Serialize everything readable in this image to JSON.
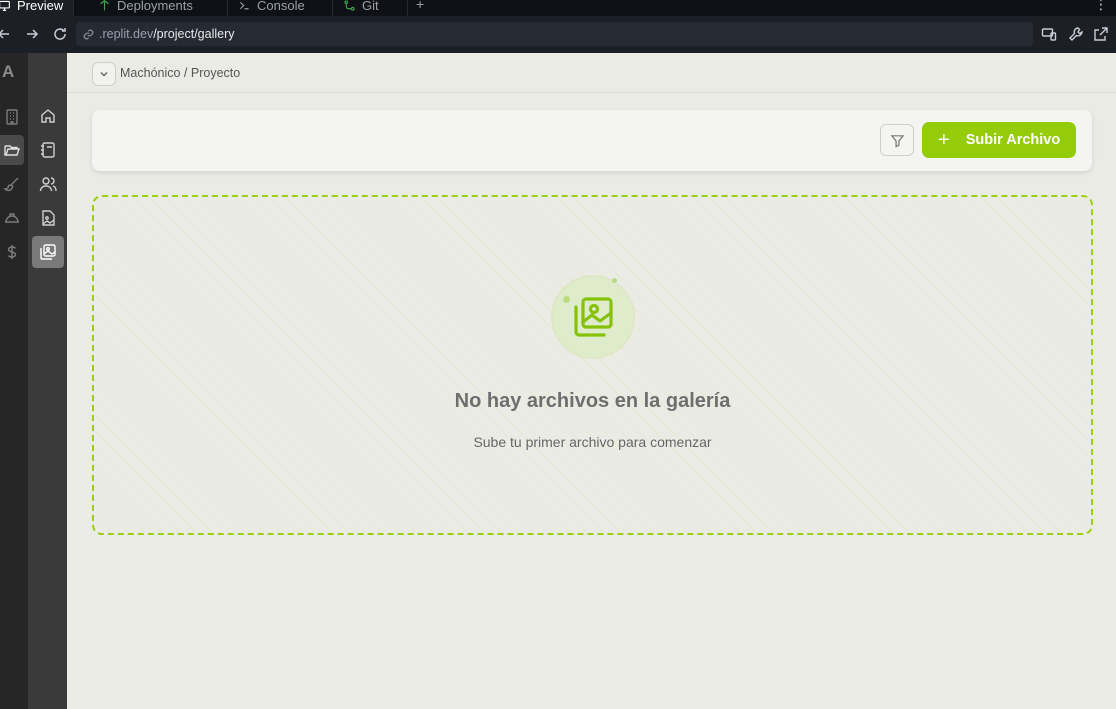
{
  "browser": {
    "tabs": [
      {
        "label": "Preview",
        "icon": "monitor-icon",
        "active": true
      },
      {
        "label": "Deployments",
        "icon": "deploy-icon",
        "active": false
      },
      {
        "label": "Console",
        "icon": "terminal-icon",
        "active": false
      },
      {
        "label": "Git",
        "icon": "git-icon",
        "active": false
      }
    ],
    "new_tab": "+",
    "menu": "⋮",
    "url_host": ".replit.dev",
    "url_path": "/project/gallery"
  },
  "rail1": {
    "logo": "A",
    "items": [
      {
        "icon": "building-icon",
        "selected": false
      },
      {
        "icon": "folder-open-icon",
        "selected": true
      },
      {
        "icon": "brush-icon",
        "selected": false
      },
      {
        "icon": "helmet-icon",
        "selected": false
      },
      {
        "icon": "dollar-icon",
        "selected": false
      }
    ]
  },
  "rail2": {
    "items": [
      {
        "icon": "home-icon",
        "selected": false
      },
      {
        "icon": "notebook-icon",
        "selected": false
      },
      {
        "icon": "users-icon",
        "selected": false
      },
      {
        "icon": "file-image-icon",
        "selected": false
      },
      {
        "icon": "gallery-icon",
        "selected": true
      }
    ]
  },
  "breadcrumb": {
    "text": "Machónico / Proyecto"
  },
  "toolbar": {
    "upload_label": "Subir Archivo",
    "upload_plus": "+"
  },
  "empty": {
    "title": "No hay archivos en la galería",
    "subtitle": "Sube tu primer archivo para comenzar"
  },
  "colors": {
    "accent": "#95cc0a",
    "dashed_border": "#9ccf12",
    "page_bg": "#ebebe6"
  }
}
